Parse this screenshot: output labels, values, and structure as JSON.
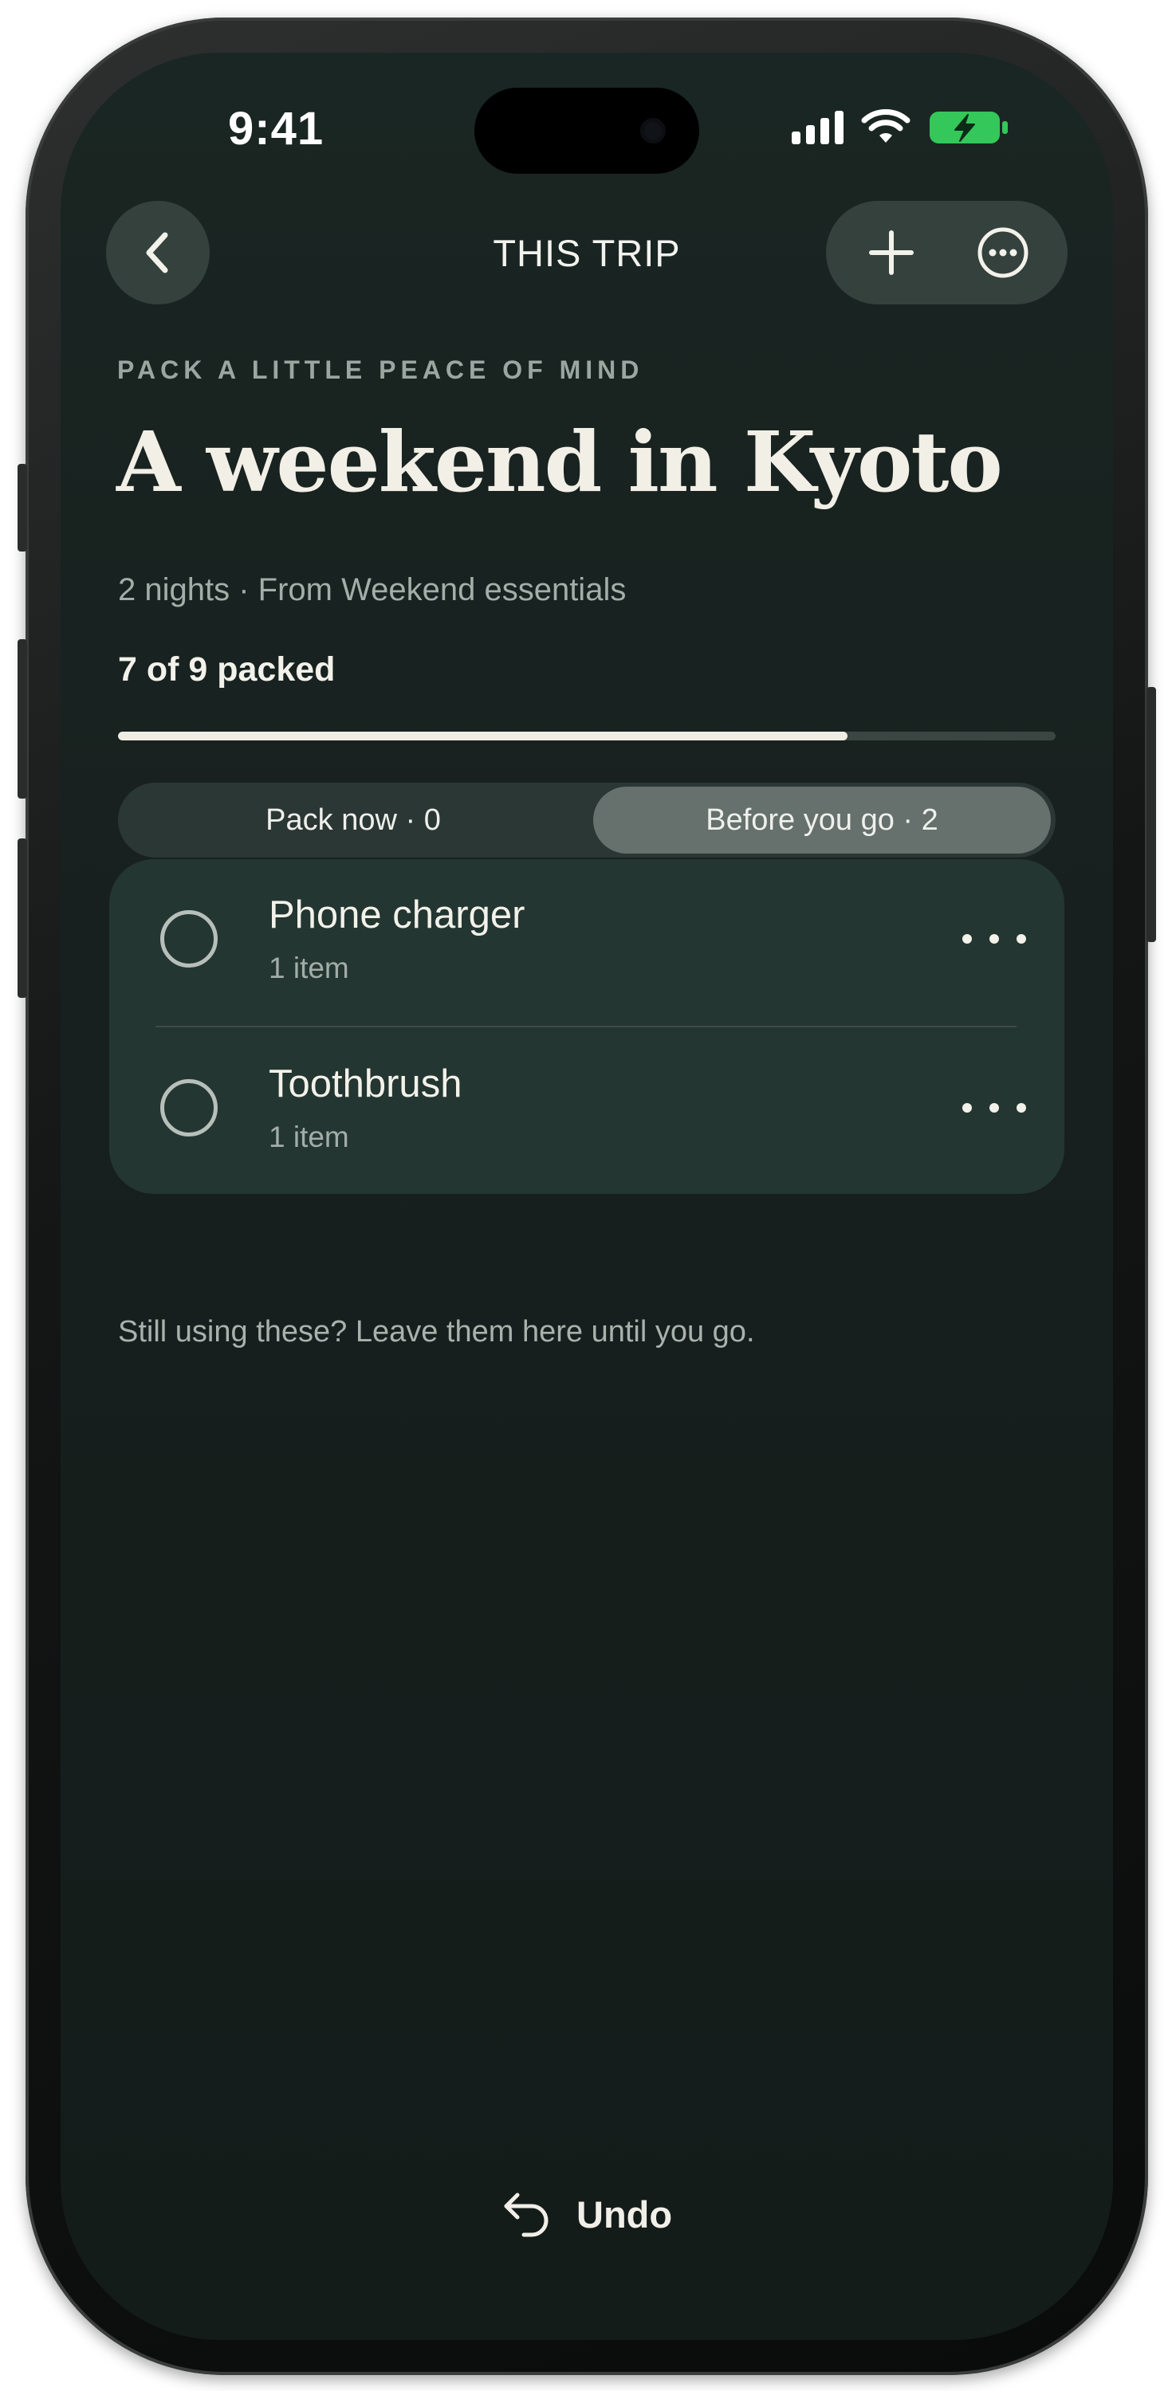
{
  "status_bar": {
    "time": "9:41"
  },
  "nav": {
    "title": "THIS TRIP",
    "back_icon": "chevron-left-icon",
    "add_icon": "plus-icon",
    "more_icon": "ellipsis-circle-icon"
  },
  "header": {
    "eyebrow": "PACK A LITTLE PEACE OF MIND",
    "title": "A weekend in Kyoto",
    "subtitle": "2 nights · From Weekend essentials",
    "progress_label": "7 of 9 packed",
    "progress_fraction": 0.778
  },
  "segmented": {
    "tabs": [
      {
        "label": "Pack now · 0",
        "selected": false
      },
      {
        "label": "Before you go · 2",
        "selected": true
      }
    ]
  },
  "items": [
    {
      "title": "Phone charger",
      "detail": "1 item",
      "checked": false
    },
    {
      "title": "Toothbrush",
      "detail": "1 item",
      "checked": false
    }
  ],
  "hint": "Still using these? Leave them here until you go.",
  "undo": {
    "label": "Undo",
    "icon": "undo-arrow-icon"
  },
  "colors": {
    "background": "#17201e",
    "card": "#243631",
    "accent_text": "#f1efe6",
    "battery_green": "#34c759"
  }
}
